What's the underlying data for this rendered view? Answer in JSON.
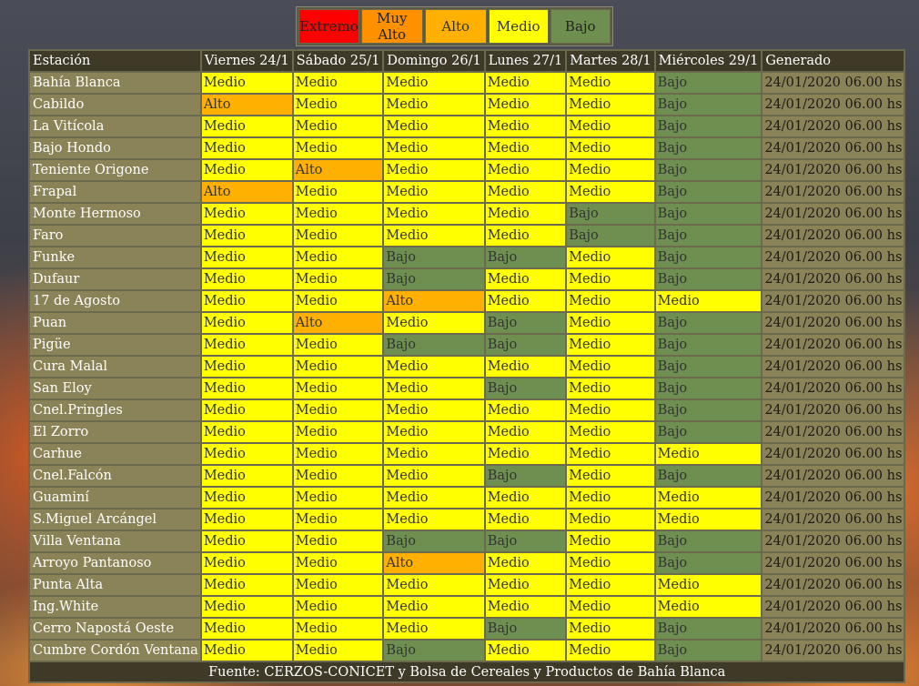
{
  "legend": [
    {
      "label": "Extremo",
      "level": "Extremo"
    },
    {
      "label": "Muy Alto",
      "level": "MuyAlto"
    },
    {
      "label": "Alto",
      "level": "Alto"
    },
    {
      "label": "Medio",
      "level": "Medio"
    },
    {
      "label": "Bajo",
      "level": "Bajo"
    }
  ],
  "colors": {
    "Extremo": "#ff0000",
    "MuyAlto": "#ff9000",
    "Alto": "#ffb000",
    "Medio": "#ffff00",
    "Bajo": "#6f8f50",
    "header_bg": "#3f3a28",
    "station_bg": "#8b8358"
  },
  "table": {
    "headers": [
      "Estación",
      "Viernes 24/1",
      "Sábado 25/1",
      "Domingo 26/1",
      "Lunes 27/1",
      "Martes 28/1",
      "Miércoles 29/1",
      "Generado"
    ],
    "rows": [
      {
        "station": "Bahía Blanca",
        "days": [
          "Medio",
          "Medio",
          "Medio",
          "Medio",
          "Medio",
          "Bajo"
        ],
        "generated": "24/01/2020 06.00 hs"
      },
      {
        "station": "Cabildo",
        "days": [
          "Alto",
          "Medio",
          "Medio",
          "Medio",
          "Medio",
          "Bajo"
        ],
        "generated": "24/01/2020 06.00 hs"
      },
      {
        "station": "La Vitícola",
        "days": [
          "Medio",
          "Medio",
          "Medio",
          "Medio",
          "Medio",
          "Bajo"
        ],
        "generated": "24/01/2020 06.00 hs"
      },
      {
        "station": "Bajo Hondo",
        "days": [
          "Medio",
          "Medio",
          "Medio",
          "Medio",
          "Medio",
          "Bajo"
        ],
        "generated": "24/01/2020 06.00 hs"
      },
      {
        "station": "Teniente Origone",
        "days": [
          "Medio",
          "Alto",
          "Medio",
          "Medio",
          "Medio",
          "Bajo"
        ],
        "generated": "24/01/2020 06.00 hs"
      },
      {
        "station": "Frapal",
        "days": [
          "Alto",
          "Medio",
          "Medio",
          "Medio",
          "Medio",
          "Bajo"
        ],
        "generated": "24/01/2020 06.00 hs"
      },
      {
        "station": "Monte Hermoso",
        "days": [
          "Medio",
          "Medio",
          "Medio",
          "Medio",
          "Bajo",
          "Bajo"
        ],
        "generated": "24/01/2020 06.00 hs"
      },
      {
        "station": "Faro",
        "days": [
          "Medio",
          "Medio",
          "Medio",
          "Medio",
          "Bajo",
          "Bajo"
        ],
        "generated": "24/01/2020 06.00 hs"
      },
      {
        "station": "Funke",
        "days": [
          "Medio",
          "Medio",
          "Bajo",
          "Bajo",
          "Medio",
          "Bajo"
        ],
        "generated": "24/01/2020 06.00 hs"
      },
      {
        "station": "Dufaur",
        "days": [
          "Medio",
          "Medio",
          "Bajo",
          "Medio",
          "Medio",
          "Bajo"
        ],
        "generated": "24/01/2020 06.00 hs"
      },
      {
        "station": "17 de Agosto",
        "days": [
          "Medio",
          "Medio",
          "Alto",
          "Medio",
          "Medio",
          "Medio"
        ],
        "generated": "24/01/2020 06.00 hs"
      },
      {
        "station": "Puan",
        "days": [
          "Medio",
          "Alto",
          "Medio",
          "Bajo",
          "Medio",
          "Bajo"
        ],
        "generated": "24/01/2020 06.00 hs"
      },
      {
        "station": "Pigüe",
        "days": [
          "Medio",
          "Medio",
          "Bajo",
          "Bajo",
          "Medio",
          "Bajo"
        ],
        "generated": "24/01/2020 06.00 hs"
      },
      {
        "station": "Cura Malal",
        "days": [
          "Medio",
          "Medio",
          "Medio",
          "Medio",
          "Medio",
          "Bajo"
        ],
        "generated": "24/01/2020 06.00 hs"
      },
      {
        "station": "San Eloy",
        "days": [
          "Medio",
          "Medio",
          "Medio",
          "Bajo",
          "Medio",
          "Bajo"
        ],
        "generated": "24/01/2020 06.00 hs"
      },
      {
        "station": "Cnel.Pringles",
        "days": [
          "Medio",
          "Medio",
          "Medio",
          "Medio",
          "Medio",
          "Bajo"
        ],
        "generated": "24/01/2020 06.00 hs"
      },
      {
        "station": "El Zorro",
        "days": [
          "Medio",
          "Medio",
          "Medio",
          "Medio",
          "Medio",
          "Bajo"
        ],
        "generated": "24/01/2020 06.00 hs"
      },
      {
        "station": "Carhue",
        "days": [
          "Medio",
          "Medio",
          "Medio",
          "Medio",
          "Medio",
          "Medio"
        ],
        "generated": "24/01/2020 06.00 hs"
      },
      {
        "station": "Cnel.Falcón",
        "days": [
          "Medio",
          "Medio",
          "Medio",
          "Bajo",
          "Medio",
          "Bajo"
        ],
        "generated": "24/01/2020 06.00 hs"
      },
      {
        "station": "Guaminí",
        "days": [
          "Medio",
          "Medio",
          "Medio",
          "Medio",
          "Medio",
          "Medio"
        ],
        "generated": "24/01/2020 06.00 hs"
      },
      {
        "station": "S.Miguel Arcángel",
        "days": [
          "Medio",
          "Medio",
          "Medio",
          "Medio",
          "Medio",
          "Medio"
        ],
        "generated": "24/01/2020 06.00 hs"
      },
      {
        "station": "Villa Ventana",
        "days": [
          "Medio",
          "Medio",
          "Bajo",
          "Bajo",
          "Medio",
          "Bajo"
        ],
        "generated": "24/01/2020 06.00 hs"
      },
      {
        "station": "Arroyo Pantanoso",
        "days": [
          "Medio",
          "Medio",
          "Alto",
          "Medio",
          "Medio",
          "Bajo"
        ],
        "generated": "24/01/2020 06.00 hs"
      },
      {
        "station": "Punta Alta",
        "days": [
          "Medio",
          "Medio",
          "Medio",
          "Medio",
          "Medio",
          "Medio"
        ],
        "generated": "24/01/2020 06.00 hs"
      },
      {
        "station": "Ing.White",
        "days": [
          "Medio",
          "Medio",
          "Medio",
          "Medio",
          "Medio",
          "Medio"
        ],
        "generated": "24/01/2020 06.00 hs"
      },
      {
        "station": "Cerro Napostá Oeste",
        "days": [
          "Medio",
          "Medio",
          "Medio",
          "Bajo",
          "Medio",
          "Bajo"
        ],
        "generated": "24/01/2020 06.00 hs"
      },
      {
        "station": "Cumbre Cordón Ventana",
        "days": [
          "Medio",
          "Medio",
          "Bajo",
          "Medio",
          "Medio",
          "Bajo"
        ],
        "generated": "24/01/2020 06.00 hs"
      }
    ],
    "footer": "Fuente: CERZOS-CONICET y Bolsa de Cereales y Productos de Bahía Blanca"
  }
}
